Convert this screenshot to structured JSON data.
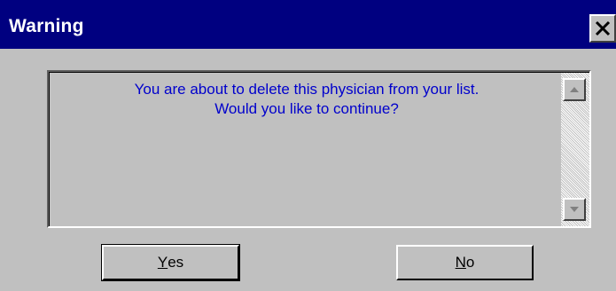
{
  "window": {
    "title": "Warning",
    "close_icon": "close-icon"
  },
  "message": {
    "line1": "You are about to delete this physician from your list.",
    "line2": "Would you like to continue?",
    "color": "#0000cc"
  },
  "scrollbar": {
    "up_icon": "scroll-up-arrow-icon",
    "down_icon": "scroll-down-arrow-icon"
  },
  "buttons": {
    "yes": {
      "mnemonic": "Y",
      "rest": "es"
    },
    "no": {
      "mnemonic": "N",
      "rest": "o"
    }
  },
  "colors": {
    "titlebar": "#000080",
    "face": "#c0c0c0"
  }
}
